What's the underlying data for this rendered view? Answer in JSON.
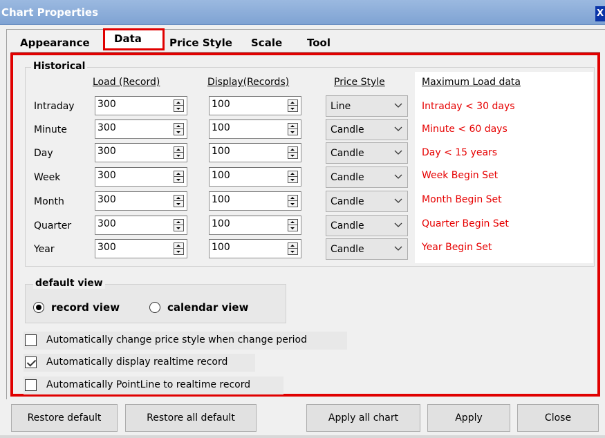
{
  "window": {
    "title": "Chart Properties",
    "close_label": "X"
  },
  "tabs": [
    "Appearance",
    "Data",
    "Price Style",
    "Scale",
    "Tool"
  ],
  "active_tab": "Data",
  "historical": {
    "group_title": "Historical",
    "headers": {
      "load": "Load (Record)",
      "display": "Display(Records)",
      "price_style": "Price Style",
      "max_load": "Maximum Load data"
    },
    "rows": [
      {
        "label": "Intraday",
        "load": "300",
        "display": "100",
        "price_style": "Line",
        "max_load": "Intraday < 30 days"
      },
      {
        "label": "Minute",
        "load": "300",
        "display": "100",
        "price_style": "Candle",
        "max_load": "Minute < 60 days"
      },
      {
        "label": "Day",
        "load": "300",
        "display": "100",
        "price_style": "Candle",
        "max_load": "Day < 15 years"
      },
      {
        "label": "Week",
        "load": "300",
        "display": "100",
        "price_style": "Candle",
        "max_load": "Week Begin Set"
      },
      {
        "label": "Month",
        "load": "300",
        "display": "100",
        "price_style": "Candle",
        "max_load": "Month Begin Set"
      },
      {
        "label": "Quarter",
        "load": "300",
        "display": "100",
        "price_style": "Candle",
        "max_load": "Quarter Begin Set"
      },
      {
        "label": "Year",
        "load": "300",
        "display": "100",
        "price_style": "Candle",
        "max_load": "Year Begin Set"
      }
    ]
  },
  "default_view": {
    "group_title": "default view",
    "options": [
      {
        "label": "record view",
        "checked": true
      },
      {
        "label": "calendar view",
        "checked": false
      }
    ]
  },
  "checkboxes": [
    {
      "label": "Automatically change price style when change period",
      "checked": false
    },
    {
      "label": "Automatically display realtime record",
      "checked": true
    },
    {
      "label": "Automatically PointLine to realtime record",
      "checked": false
    }
  ],
  "buttons": {
    "restore_default": "Restore default",
    "restore_all_default": "Restore all default",
    "apply_all_chart": "Apply all chart",
    "apply": "Apply",
    "close": "Close"
  },
  "colors": {
    "highlight_border": "#e00000",
    "max_load_text": "#e60000",
    "titlebar": "#8aaedb"
  }
}
